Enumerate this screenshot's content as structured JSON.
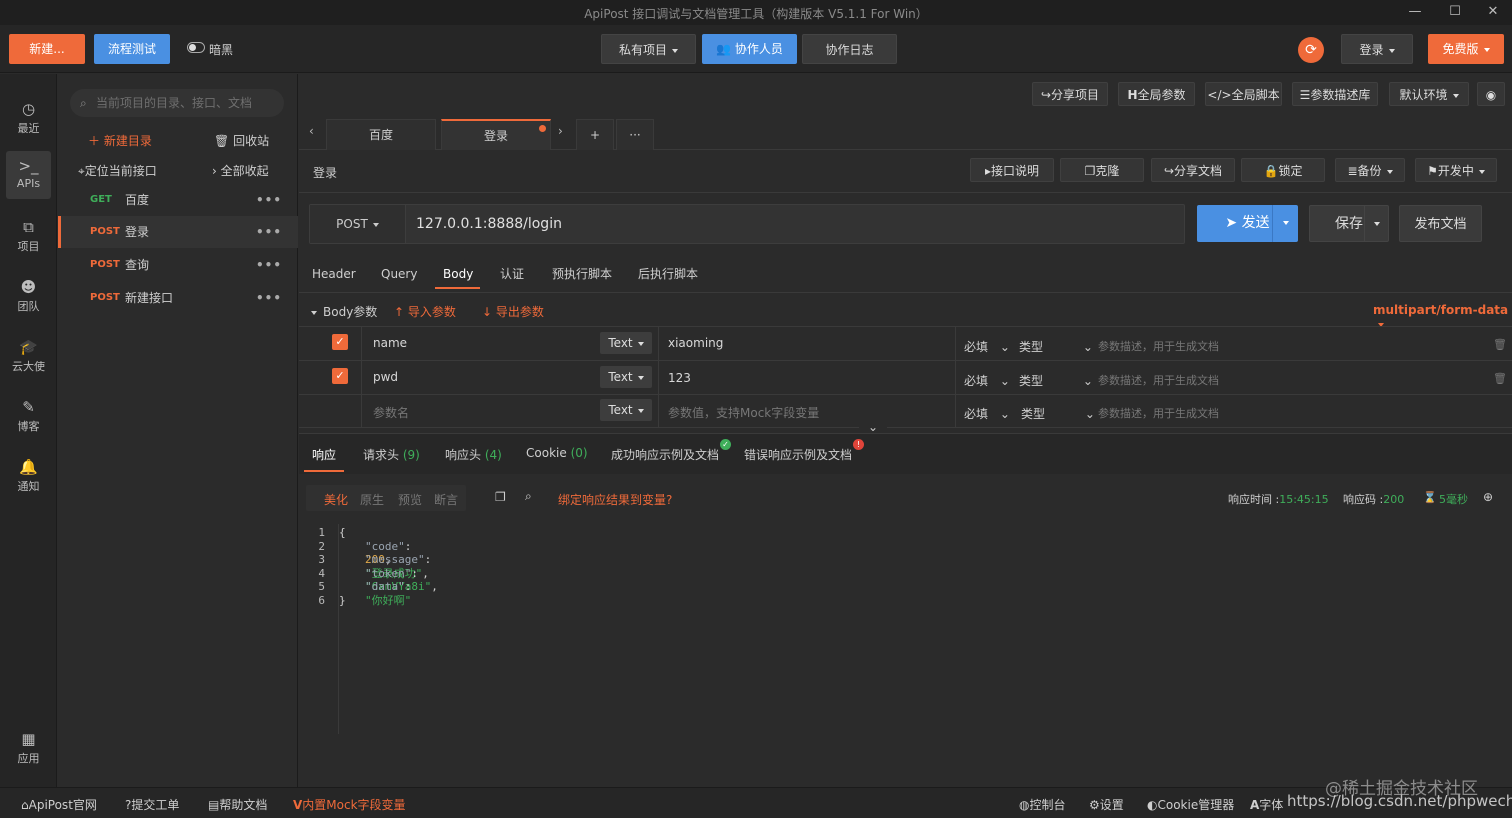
{
  "window": {
    "title": "ApiPost 接口调试与文档管理工具（构建版本 V5.1.1 For Win）"
  },
  "toolbar": {
    "new_label": "新建...",
    "flow_test_label": "流程测试",
    "dark_label": "暗黑",
    "private_project_label": "私有项目",
    "collaborators_label": "协作人员",
    "collab_log_label": "协作日志",
    "login_label": "登录",
    "free_label": "免费版"
  },
  "rail": [
    {
      "icon": "clock-icon",
      "label": "最近"
    },
    {
      "icon": "terminal-icon",
      "label": "APIs"
    },
    {
      "icon": "project-icon",
      "label": "项目"
    },
    {
      "icon": "team-icon",
      "label": "团队"
    },
    {
      "icon": "graduation-cap-icon",
      "label": "云大使"
    },
    {
      "icon": "edit-icon",
      "label": "博客"
    },
    {
      "icon": "bell-icon",
      "label": "通知"
    },
    {
      "icon": "apps-icon",
      "label": "应用"
    }
  ],
  "tree": {
    "search_placeholder": "当前项目的目录、接口、文档",
    "new_dir_label": "新建目录",
    "recycle_label": "回收站",
    "locate_label": "定位当前接口",
    "collapse_label": "全部收起",
    "items": [
      {
        "method": "GET",
        "name": "百度"
      },
      {
        "method": "POST",
        "name": "登录"
      },
      {
        "method": "POST",
        "name": "查询"
      },
      {
        "method": "POST",
        "name": "新建接口"
      }
    ]
  },
  "topbar": {
    "share_project": "分享项目",
    "global_params": "全局参数",
    "global_script": "全局脚本",
    "param_desc_lib": "参数描述库",
    "default_env": "默认环境"
  },
  "tabs": [
    {
      "label": "百度"
    },
    {
      "label": "登录"
    }
  ],
  "request": {
    "title": "登录",
    "api_desc": "接口说明",
    "clone": "克隆",
    "share_doc": "分享文档",
    "lock": "锁定",
    "backup": "备份",
    "status": "开发中",
    "method": "POST",
    "url": "127.0.0.1:8888/login",
    "send": "发送",
    "save": "保存",
    "publish": "发布文档"
  },
  "req_tabs": [
    "Header",
    "Query",
    "Body",
    "认证",
    "预执行脚本",
    "后执行脚本"
  ],
  "body": {
    "section_label": "Body参数",
    "import_label": "导入参数",
    "export_label": "导出参数",
    "content_type": "multipart/form-data",
    "rows": [
      {
        "name": "name",
        "type": "Text",
        "value": "xiaoming",
        "required": "必填",
        "kind": "类型",
        "desc": "参数描述，用于生成文档"
      },
      {
        "name": "pwd",
        "type": "Text",
        "value": "123",
        "required": "必填",
        "kind": "类型",
        "desc": "参数描述，用于生成文档"
      },
      {
        "name": "参数名",
        "type": "Text",
        "value": "参数值，支持Mock字段变量",
        "required": "必填",
        "kind": "类型",
        "desc": "参数描述，用于生成文档"
      }
    ]
  },
  "resp_tabs": {
    "response": "响应",
    "req_headers": "请求头",
    "req_headers_count": "(9)",
    "resp_headers": "响应头",
    "resp_headers_count": "(4)",
    "cookie": "Cookie",
    "cookie_count": "(0)",
    "success_example": "成功响应示例及文档",
    "error_example": "错误响应示例及文档"
  },
  "resp_tools": {
    "pretty": "美化",
    "raw": "原生",
    "preview": "预览",
    "assert": "断言",
    "bind_label": "绑定响应结果到变量?",
    "time_label": "响应时间 :",
    "time_value": "15:45:15",
    "code_label": "响应码 :",
    "code_value": "200",
    "duration_value": "5毫秒"
  },
  "code": [
    {
      "n": "1",
      "text": "{"
    },
    {
      "n": "2",
      "key": "\"code\"",
      "value": "200"
    },
    {
      "n": "3",
      "key": "\"message\"",
      "value": "\"登录成功\""
    },
    {
      "n": "4",
      "key": "\"token\"",
      "value": "\"6xmVYa8i\""
    },
    {
      "n": "5",
      "key": "\"data\"",
      "value": "\"你好啊\""
    },
    {
      "n": "6",
      "text": "}"
    }
  ],
  "statusbar": {
    "official": "ApiPost官网",
    "ticket": "提交工单",
    "help": "帮助文档",
    "mock": "内置Mock字段变量",
    "console": "控制台",
    "settings": "设置",
    "cookie_mgr": "Cookie管理器",
    "font": "字体",
    "watermark1": "@稀土掘金技术社区",
    "watermark2": "https://blog.csdn.net/phpwechat"
  }
}
